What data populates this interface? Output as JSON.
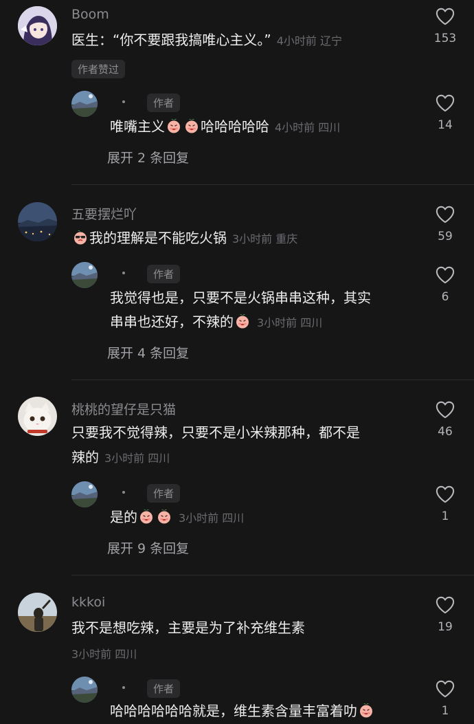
{
  "colors": {
    "background": "#161617",
    "username": "#8c8c90",
    "text": "#ededed",
    "meta": "#6b6b70"
  },
  "threads": [
    {
      "user": "Boom",
      "text": "医生：“你不要跟我搞唯心主义。”",
      "meta": "4小时前 辽宁",
      "likes": "153",
      "author_liked_badge": "作者赞过",
      "reply": {
        "badge": "作者",
        "text_before": "唯嘴主义",
        "text_after": "哈哈哈哈哈",
        "meta": "4小时前 四川",
        "likes": "14"
      },
      "expand": "展开 2 条回复"
    },
    {
      "user": "五要摆烂吖",
      "text": "我的理解是不能吃火锅",
      "meta": "3小时前 重庆",
      "likes": "59",
      "reply": {
        "badge": "作者",
        "line1": "我觉得也是，只要不是火锅串串这种，其实",
        "line2": "串串也还好，不辣的",
        "meta": "3小时前 四川",
        "likes": "6"
      },
      "expand": "展开 4 条回复"
    },
    {
      "user": "桃桃的望仔是只猫",
      "line1": "只要我不觉得辣，只要不是小米辣那种，都不是",
      "line2": "辣的",
      "meta": "3小时前 四川",
      "likes": "46",
      "reply": {
        "badge": "作者",
        "text": "是的",
        "meta": "3小时前 四川",
        "likes": "1"
      },
      "expand": "展开 9 条回复"
    },
    {
      "user": "kkkoi",
      "text": "我不是想吃辣，主要是为了补充维生素",
      "meta": "3小时前 四川",
      "likes": "19",
      "reply": {
        "badge": "作者",
        "text": "哈哈哈哈哈哈就是，维生素含量丰富着叻",
        "likes": "1"
      }
    }
  ]
}
